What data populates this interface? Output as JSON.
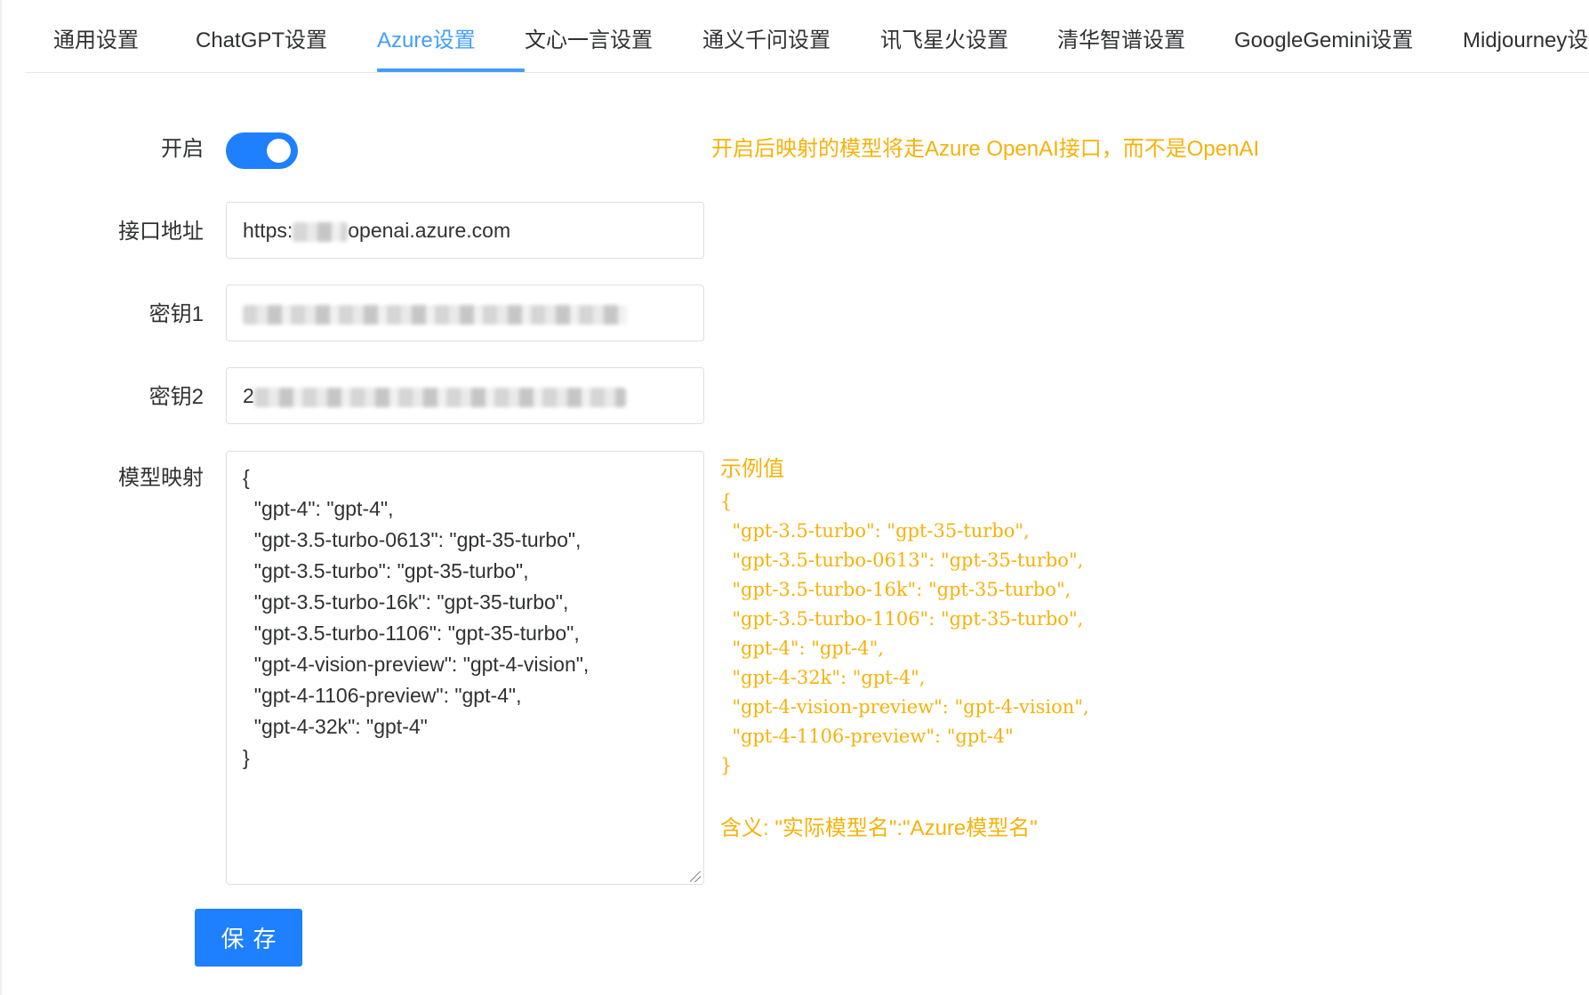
{
  "tabs": [
    {
      "label": "通用设置"
    },
    {
      "label": "ChatGPT设置"
    },
    {
      "label": "Azure设置"
    },
    {
      "label": "文心一言设置"
    },
    {
      "label": "通义千问设置"
    },
    {
      "label": "讯飞星火设置"
    },
    {
      "label": "清华智谱设置"
    },
    {
      "label": "GoogleGemini设置"
    },
    {
      "label": "Midjourney设置"
    }
  ],
  "active_tab": "Azure设置",
  "form": {
    "enable_label": "开启",
    "enable_value": true,
    "enable_hint": "开启后映射的模型将走Azure OpenAI接口，而不是OpenAI",
    "endpoint_label": "接口地址",
    "endpoint_prefix": "https:",
    "endpoint_suffix": "openai.azure.com",
    "key1_label": "密钥1",
    "key2_label": "密钥2",
    "key2_prefix": "2",
    "mapping_label": "模型映射",
    "mapping_value": "{\n  \"gpt-4\": \"gpt-4\",\n  \"gpt-3.5-turbo-0613\": \"gpt-35-turbo\",\n  \"gpt-3.5-turbo\": \"gpt-35-turbo\",\n  \"gpt-3.5-turbo-16k\": \"gpt-35-turbo\",\n  \"gpt-3.5-turbo-1106\": \"gpt-35-turbo\",\n  \"gpt-4-vision-preview\": \"gpt-4-vision\",\n  \"gpt-4-1106-preview\": \"gpt-4\",\n  \"gpt-4-32k\": \"gpt-4\"\n}",
    "example_title": "示例值",
    "example_code": "{\n  \"gpt-3.5-turbo\": \"gpt-35-turbo\",\n  \"gpt-3.5-turbo-0613\": \"gpt-35-turbo\",\n  \"gpt-3.5-turbo-16k\": \"gpt-35-turbo\",\n  \"gpt-3.5-turbo-1106\": \"gpt-35-turbo\",\n  \"gpt-4\": \"gpt-4\",\n  \"gpt-4-32k\": \"gpt-4\",\n  \"gpt-4-vision-preview\": \"gpt-4-vision\",\n  \"gpt-4-1106-preview\": \"gpt-4\"\n}",
    "meaning": "含义: \"实际模型名\":\"Azure模型名\"",
    "save_label": "保存"
  },
  "colors": {
    "accent": "#409eff",
    "primary_button": "#1e80ff",
    "hint": "#f6b20b"
  }
}
